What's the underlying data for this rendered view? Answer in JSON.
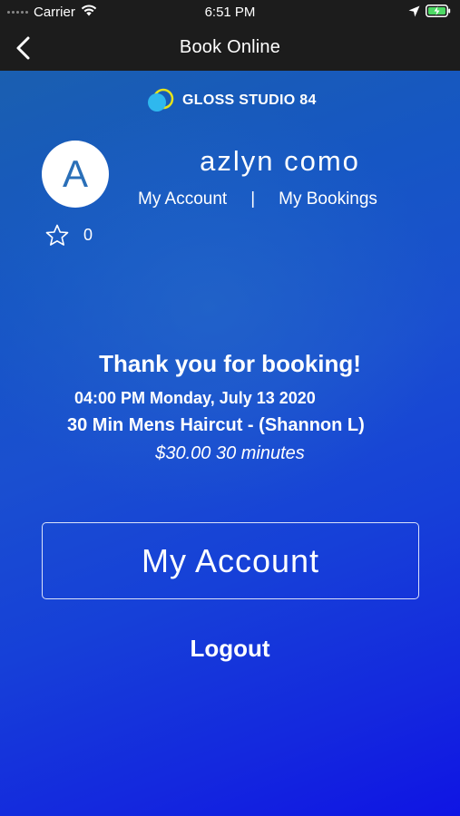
{
  "status_bar": {
    "carrier": "Carrier",
    "time": "6:51 PM"
  },
  "nav": {
    "title": "Book Online"
  },
  "brand": {
    "name": "GLOSS STUDIO 84"
  },
  "profile": {
    "avatar_letter": "A",
    "name": "azlyn como",
    "rating_count": "0",
    "links": {
      "account": "My Account",
      "separator": "|",
      "bookings": "My Bookings"
    }
  },
  "booking": {
    "thank_you": "Thank you for booking!",
    "datetime": "04:00 PM Monday, July 13 2020",
    "service": "30 Min Mens Haircut - (Shannon L)",
    "price_duration": "$30.00 30 minutes"
  },
  "actions": {
    "my_account": "My Account",
    "logout": "Logout"
  },
  "colors": {
    "bar_background": "#1c1c1c",
    "gradient_top": "#1a5fb0",
    "gradient_bottom": "#0f14e4",
    "logo_yellow": "#e6e31a",
    "logo_cyan": "#2fb8ee",
    "avatar_letter": "#2a6fb8",
    "battery_green": "#4cd964"
  },
  "icons": {
    "back": "chevron-left-icon",
    "wifi": "wifi-icon",
    "location": "location-arrow-icon",
    "battery": "battery-charging-icon",
    "star": "star-outline-icon"
  }
}
